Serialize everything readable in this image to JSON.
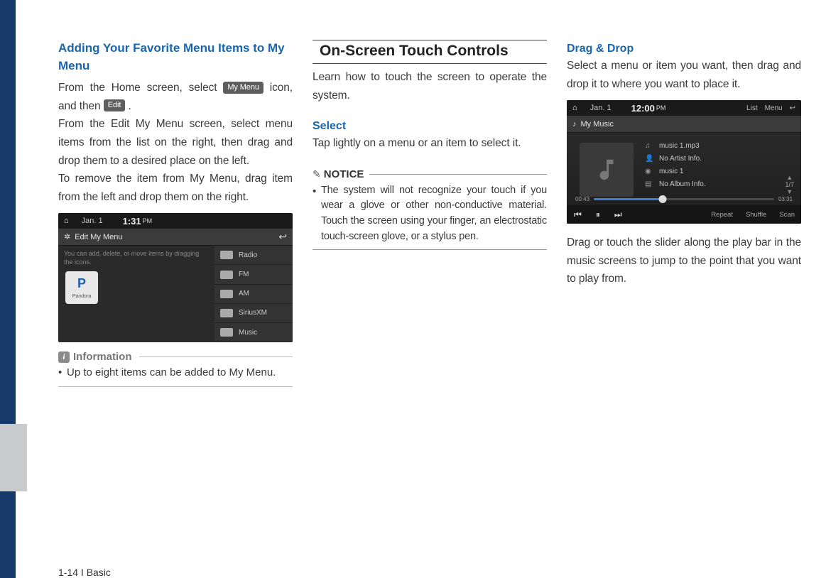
{
  "col1": {
    "heading": "Adding Your Favorite Menu Items to My Menu",
    "p1a": "From the Home screen, select ",
    "chip1": "My Menu",
    "p1b": " icon, and then ",
    "chip2": "Edit",
    "p1c": " .",
    "p2": "From the Edit My Menu screen, select menu items from the list on the right, then drag and drop them to a desired place on the left.",
    "p3": "To remove the item from My Menu, drag item from the left and drop them on the right.",
    "info_label": "Information",
    "info_bullet": "Up to eight items can be added to My Menu.",
    "shot": {
      "date": "Jan. 1",
      "time": "1:31",
      "ampm": "PM",
      "subtitle": "Edit My Menu",
      "hint": "You can add, delete, or move items by dragging the icons.",
      "pandora_letter": "P",
      "pandora_label": "Pandora",
      "rows": [
        "Radio",
        "FM",
        "AM",
        "SiriusXM",
        "Music"
      ]
    }
  },
  "col2": {
    "section_title": "On-Screen Touch Controls",
    "intro": "Learn how to touch the screen to operate the system.",
    "select_h": "Select",
    "select_p": "Tap lightly on a menu or an item to select it.",
    "notice_label": "NOTICE",
    "notice_bullet": "The system will not recognize your touch if you wear a glove or other non-conductive material. Touch the screen using your finger, an electrostatic touch-screen glove, or a stylus pen."
  },
  "col3": {
    "drag_h": "Drag & Drop",
    "drag_p": "Select a menu or item you want, then drag and drop it to where you want to place it.",
    "after_p": "Drag or touch the slider along the play bar in the music screens to jump to the point that you want to play from.",
    "shot": {
      "date": "Jan. 1",
      "time": "12:00",
      "ampm": "PM",
      "btn_list": "List",
      "btn_menu": "Menu",
      "subtitle": "My Music",
      "track": "music 1.mp3",
      "artist": "No Artist Info.",
      "album_title": "music 1",
      "album_info": "No Album Info.",
      "page": "1/7",
      "elapsed": "00:43",
      "total": "03:31",
      "repeat": "Repeat",
      "shuffle": "Shuffle",
      "scan": "Scan"
    }
  },
  "footer": "1-14 I Basic"
}
